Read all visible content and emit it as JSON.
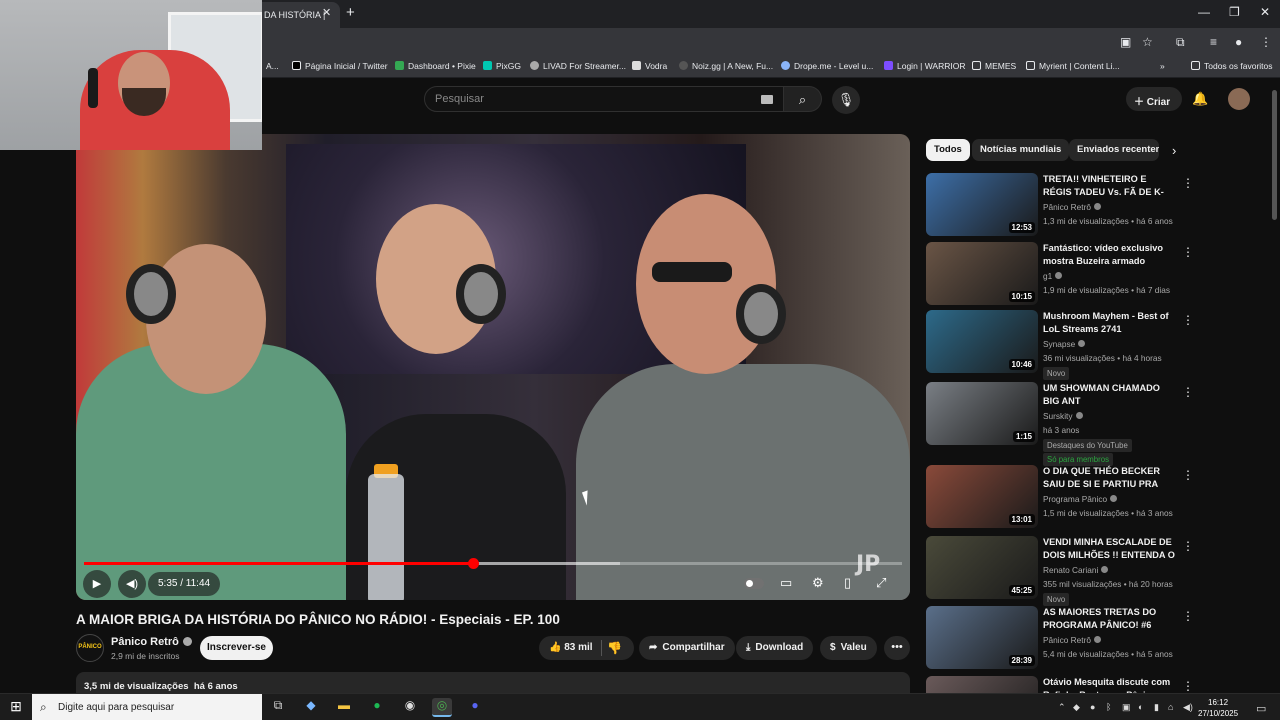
{
  "browser": {
    "active_tab_title": "A MAIOR BRIGA DA HISTÓRIA DO PÂNICO NO RÁDIO!",
    "tab_visible_text": "DA HISTÓRIA |",
    "bookmarks": [
      {
        "label": "A...",
        "color": "#8ab4f8"
      },
      {
        "label": "Página Inicial / Twitter",
        "color": "#e8eaed"
      },
      {
        "label": "Dashboard • Pixie",
        "color": "#34a853"
      },
      {
        "label": "PixGG",
        "color": "#00c7b1"
      },
      {
        "label": "LIVAD For Streamer...",
        "color": "#e8eaed"
      },
      {
        "label": "Vodra",
        "color": "#e8eaed"
      },
      {
        "label": "Noiz.gg | A New, Fu...",
        "color": "#e8eaed"
      },
      {
        "label": "Drope.me - Level u...",
        "color": "#8ab4f8"
      },
      {
        "label": "Login | WARRIOR",
        "color": "#7c4dff"
      },
      {
        "label": "MEMES",
        "color": "#e8eaed"
      },
      {
        "label": "Myrient | Content Li...",
        "color": "#e8eaed"
      }
    ],
    "all_favorites": "Todos os favoritos"
  },
  "header": {
    "search_placeholder": "Pesquisar",
    "create_label": "Criar"
  },
  "player": {
    "time": "5:35 / 11:44",
    "progress": 0.476,
    "buffered": 0.655
  },
  "video": {
    "title": "A MAIOR BRIGA DA HISTÓRIA DO PÂNICO NO RÁDIO! - Especiais - EP. 100",
    "channel": "Pânico Retrô",
    "channel_avatar_text": "PÂNICO",
    "subscribers": "2,9 mi de inscritos",
    "subscribe_label": "Inscrever-se",
    "likes": "83 mil",
    "share_label": "Compartilhar",
    "download_label": "Download",
    "thanks_label": "Valeu",
    "views": "3,5 mi de visualizações",
    "age": "há 6 anos"
  },
  "chips": [
    "Todos",
    "Notícias mundiais",
    "Enviados recentem"
  ],
  "recommendations": [
    {
      "title": "TRETA!! VINHETEIRO E RÉGIS TADEU Vs. FÃ DE K-POP! | ...",
      "channel": "Pânico Retrô",
      "views": "1,3 mi de visualizações",
      "age": "há 6 anos",
      "duration": "12:53",
      "thumb": "#3d6fa8",
      "badges": []
    },
    {
      "title": "Fantástico: vídeo exclusivo mostra Buzeira armado minut...",
      "channel": "g1",
      "views": "1,9 mi de visualizações",
      "age": "há 7 dias",
      "duration": "10:15",
      "thumb": "#6a5546",
      "badges": []
    },
    {
      "title": "Mushroom Mayhem - Best of LoL Streams 2741",
      "channel": "Synapse",
      "views": "36 mi visualizações",
      "age": "há 4 horas",
      "duration": "10:46",
      "thumb": "#2d6a8a",
      "badges": [
        "Novo"
      ]
    },
    {
      "title": "UM SHOWMAN CHAMADO BIG ANT",
      "channel": "Surskity",
      "views": "há 3 anos",
      "age": "",
      "duration": "1:15",
      "thumb": "#7a7f85",
      "badges": [
        "Destaques do YouTube",
        "Só para membros"
      ]
    },
    {
      "title": "O DIA QUE THÉO BECKER SAIU DE SI E PARTIU PRA CIMA DO ...",
      "channel": "Programa Pânico",
      "views": "1,5 mi de visualizações",
      "age": "há 3 anos",
      "duration": "13:01",
      "thumb": "#8a4a3a",
      "badges": []
    },
    {
      "title": "VENDI MINHA ESCALADE DE DOIS MILHÕES !! ENTENDA O ...",
      "channel": "Renato Cariani",
      "views": "355 mil visualizações",
      "age": "há 20 horas",
      "duration": "45:25",
      "thumb": "#4a4a3a",
      "badges": [
        "Novo"
      ]
    },
    {
      "title": "AS MAIORES TRETAS DO PROGRAMA PÂNICO! #6",
      "channel": "Pânico Retrô",
      "views": "5,4 mi de visualizações",
      "age": "há 5 anos",
      "duration": "28:39",
      "thumb": "#5a6f8a",
      "badges": []
    },
    {
      "title": "Otávio Mesquita discute com Rafinha Bastos no Pânico",
      "channel": "",
      "views": "",
      "age": "",
      "duration": "",
      "thumb": "#6a5a5a",
      "badges": []
    }
  ],
  "taskbar": {
    "search_placeholder": "Digite aqui para pesquisar",
    "time": "16:12",
    "date": "27/10/2025"
  }
}
